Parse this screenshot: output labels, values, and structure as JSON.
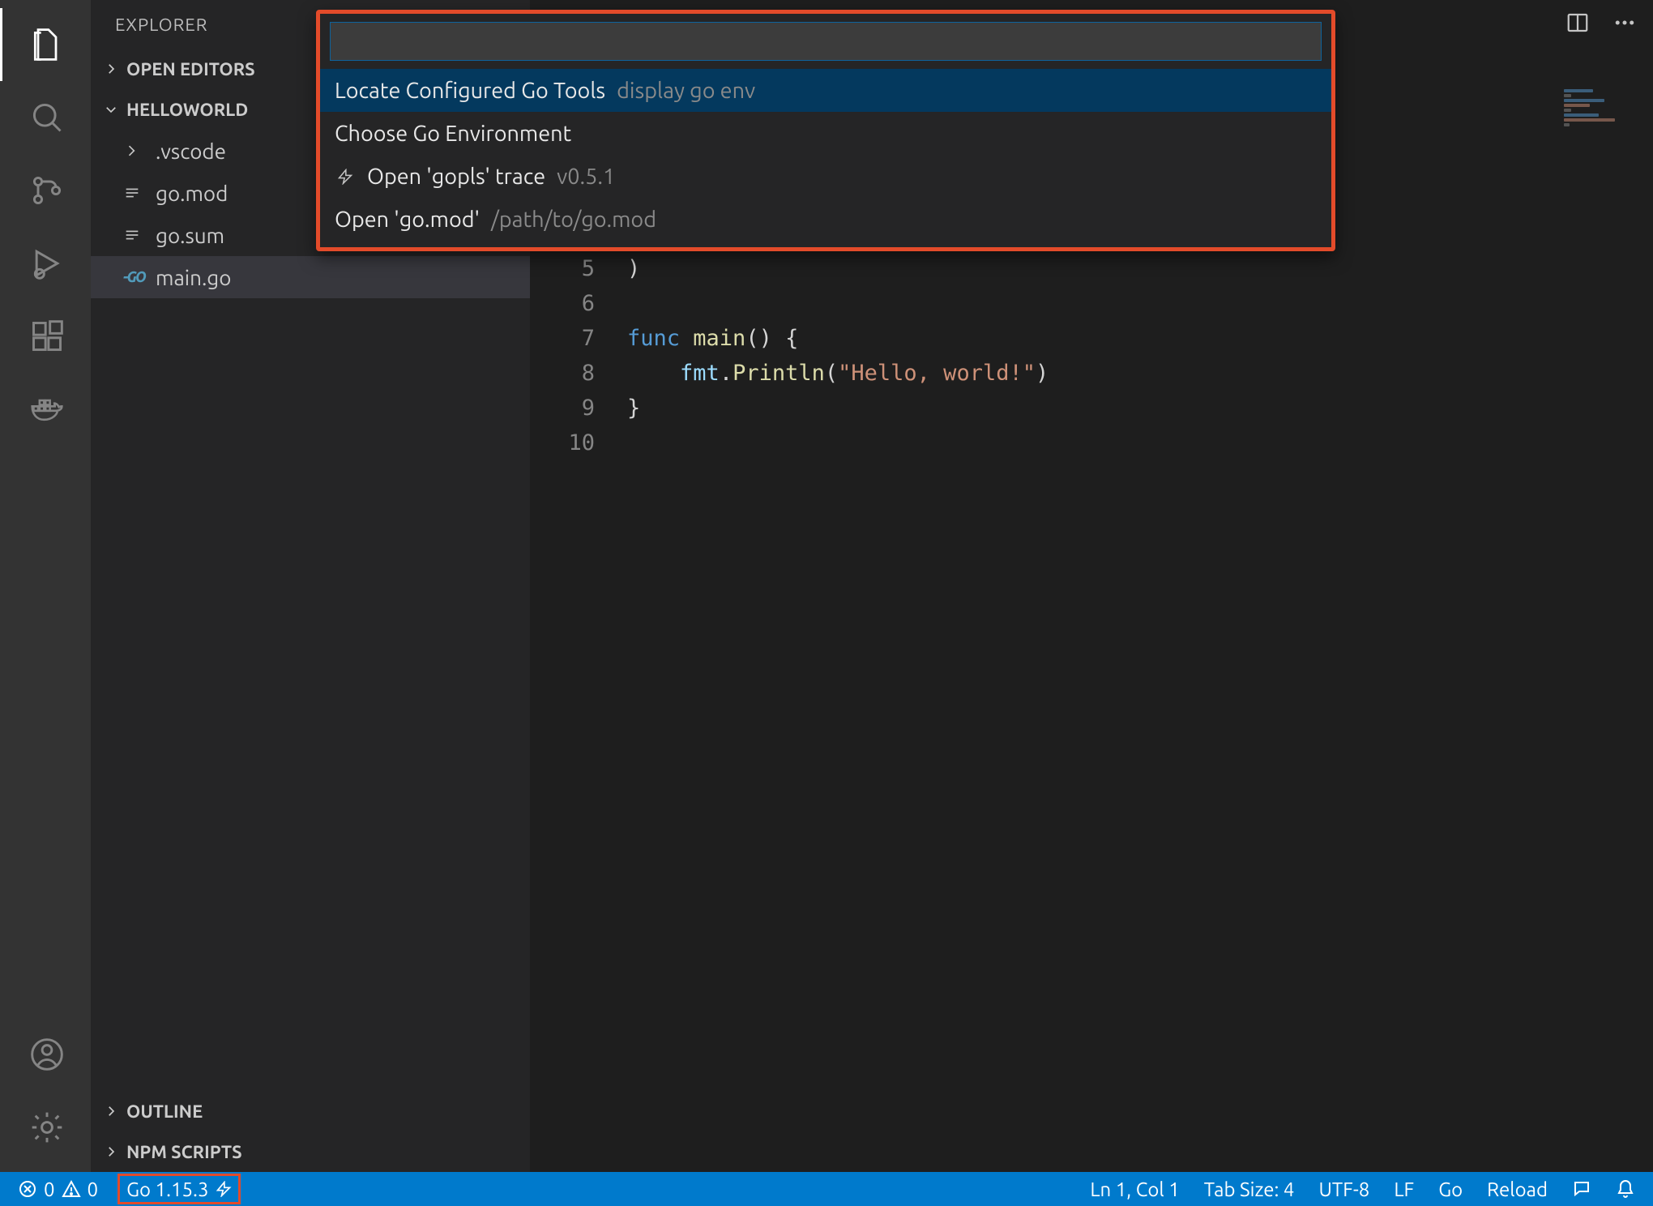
{
  "sidebar": {
    "title": "EXPLORER",
    "sections": {
      "open_editors": "OPEN EDITORS",
      "folder": "HELLOWORLD",
      "outline": "OUTLINE",
      "npm_scripts": "NPM SCRIPTS"
    },
    "tree": {
      "vscode": ".vscode",
      "gomod": "go.mod",
      "gosum": "go.sum",
      "maingo": "main.go"
    }
  },
  "quickpick": {
    "input_value": "",
    "items": [
      {
        "label": "Locate Configured Go Tools",
        "description": "display go env",
        "icon": ""
      },
      {
        "label": "Choose Go Environment",
        "description": "",
        "icon": ""
      },
      {
        "label": "Open 'gopls' trace",
        "description": "v0.5.1",
        "icon": "zap"
      },
      {
        "label": "Open 'go.mod'",
        "description": "/path/to/go.mod",
        "icon": ""
      }
    ]
  },
  "editor": {
    "lines": {
      "start": 5,
      "l5": ")",
      "l7_kw": "func",
      "l7_name": " main",
      "l7_rest": "() {",
      "l8_indent": "    ",
      "l8_obj": "fmt",
      "l8_dot": ".",
      "l8_fn": "Println",
      "l8_open": "(",
      "l8_str": "\"Hello, world!\"",
      "l8_close": ")",
      "l9": "}"
    },
    "line_numbers": [
      "5",
      "6",
      "7",
      "8",
      "9",
      "10"
    ]
  },
  "statusbar": {
    "errors": "0",
    "warnings": "0",
    "go_version": "Go 1.15.3",
    "ln_col": "Ln 1, Col 1",
    "tab_size": "Tab Size: 4",
    "encoding": "UTF-8",
    "eol": "LF",
    "language": "Go",
    "reload": "Reload"
  }
}
